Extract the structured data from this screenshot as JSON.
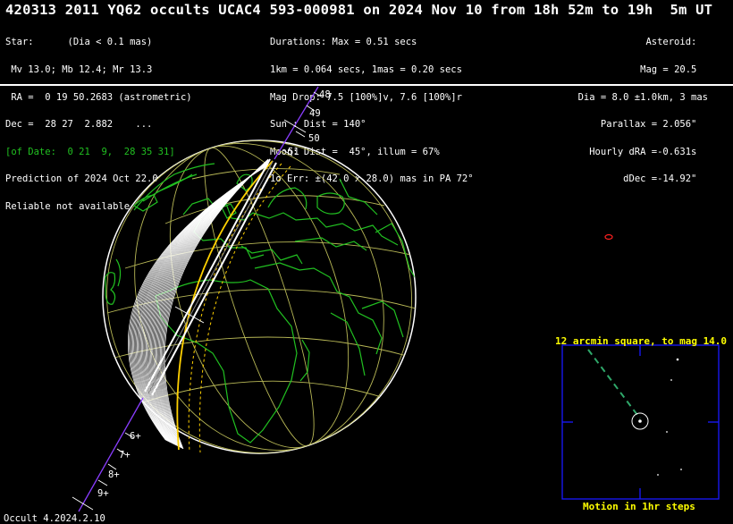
{
  "title": "420313 2011 YQ62 occults UCAC4 593-000981 on 2024 Nov 10 from 18h 52m to 19h  5m UT",
  "star": [
    "Star:      (Dia < 0.1 mas)",
    " Mv 13.0; Mb 12.4; Mr 13.3",
    " RA =  0 19 50.2683 (astrometric)",
    "Dec =  28 27  2.882    ...",
    "[of Date:  0 21  9,  28 35 31]",
    "Prediction of 2024 Oct 22.0",
    "Reliable not available"
  ],
  "event": [
    "Durations: Max = 0.51 secs",
    "1km = 0.064 secs, 1mas = 0.20 secs",
    "Mag Drop: 7.5 [100%]v, 7.6 [100%]r",
    "Sun : Dist = 140°",
    "Moon: Dist =  45°, illum = 67%",
    "1σ Err: ±(42.0 x 28.0) mas in PA 72°"
  ],
  "asteroid": [
    "Asteroid:  ",
    "Mag = 20.5  ",
    "Dia = 8.0 ±1.0km, 3 mas",
    "Parallax = 2.056\"  ",
    "Hourly dRA =-0.631s  ",
    "dDec =-14.92\"  "
  ],
  "path_ticks_top": [
    "48",
    "49",
    "50",
    "51"
  ],
  "path_ticks_bottom": [
    "6+",
    "7+",
    "8+",
    "9+"
  ],
  "inset": {
    "title": "12 arcmin square, to mag 14.0",
    "footer": "Motion in 1hr steps"
  },
  "footer": "Occult 4.2024.2.10",
  "colors": {
    "coastline": "#21c021",
    "grid": "#b8b856",
    "path": "#ffffff",
    "sigma": "#ffd000",
    "inset_frame": "#1a1aff",
    "motion": "#2fa86a",
    "label": "#ffff00"
  }
}
